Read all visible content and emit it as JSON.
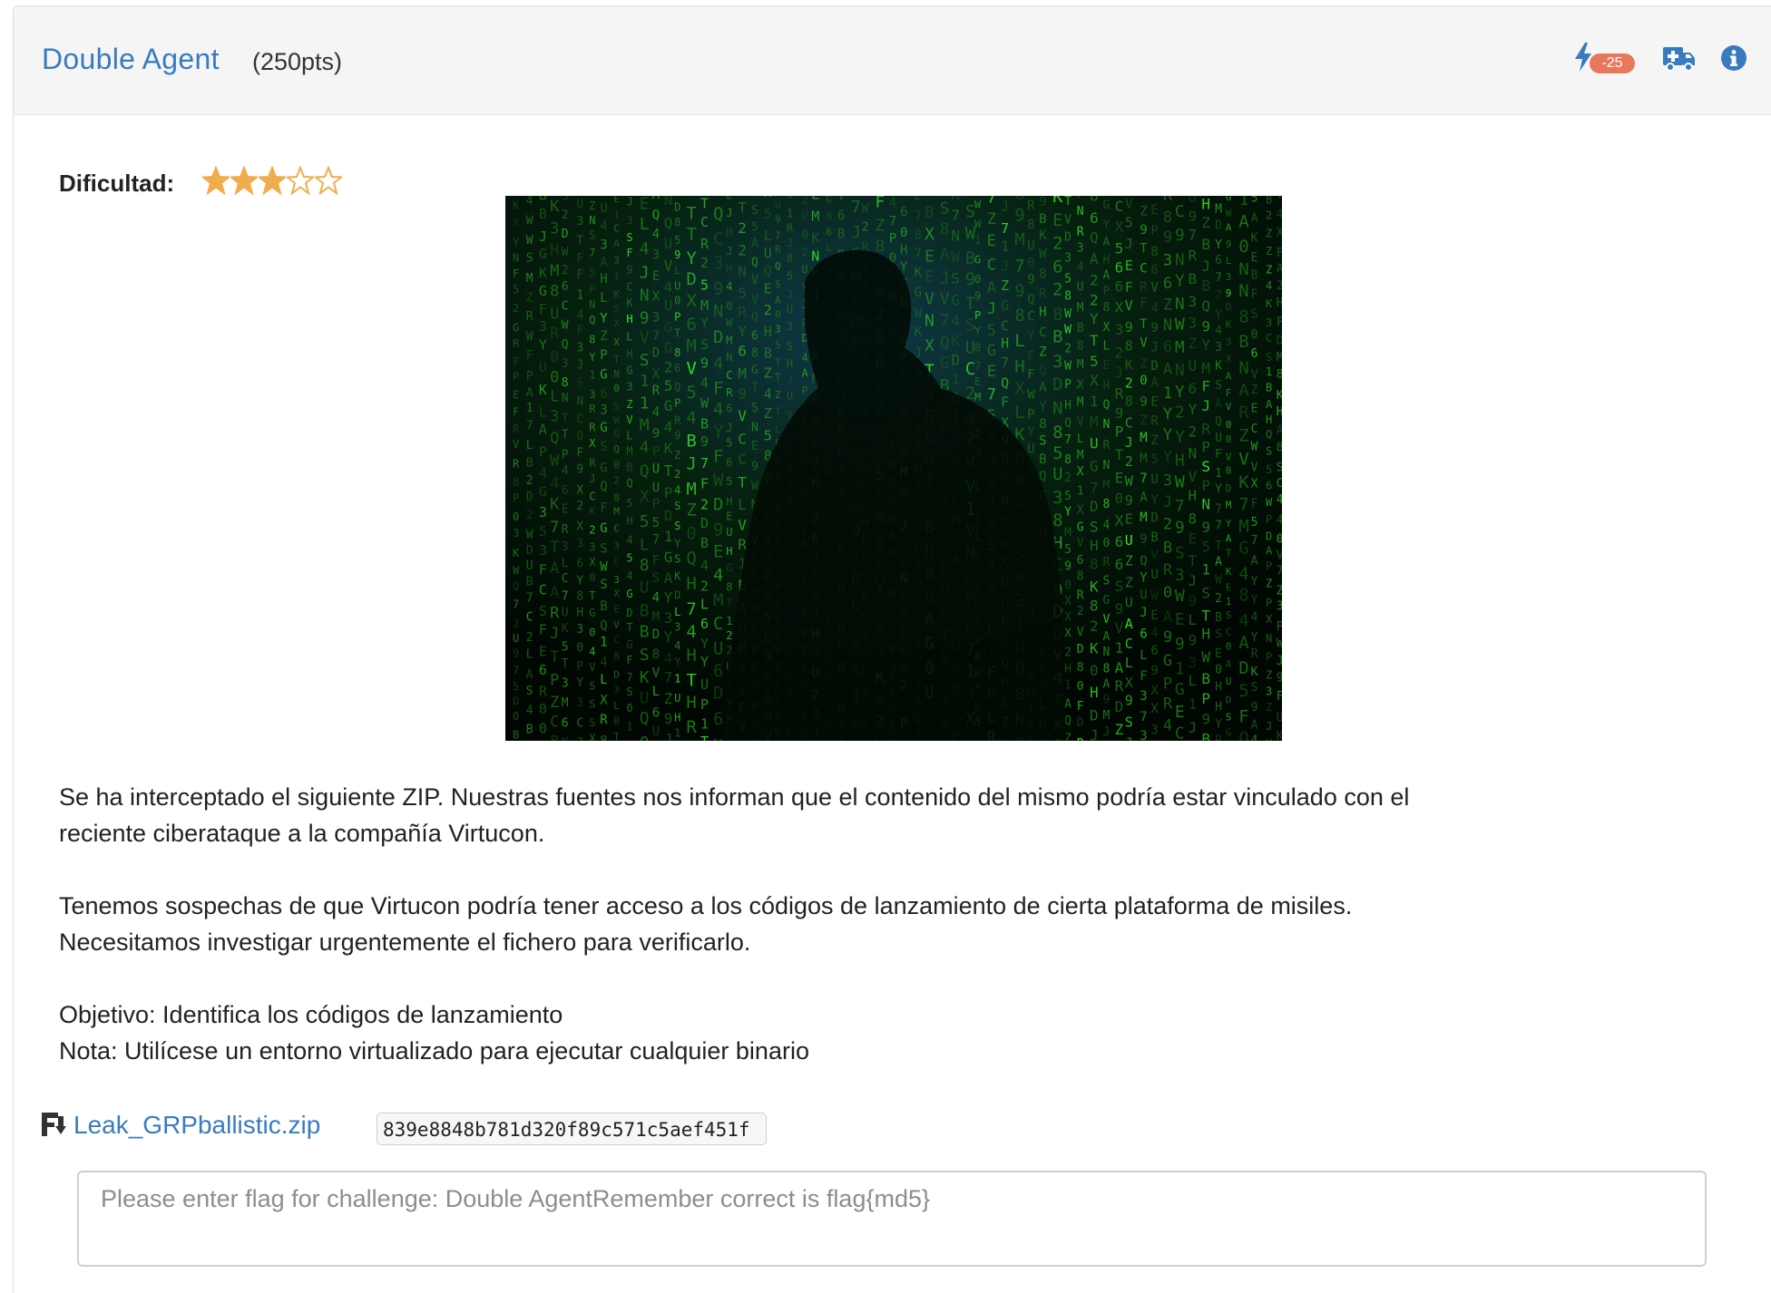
{
  "challenge": {
    "title": "Double Agent",
    "points": "(250pts)",
    "hint_penalty": "-25"
  },
  "header_icons": {
    "hint": "bolt-icon",
    "help": "ambulance-icon",
    "info": "info-icon"
  },
  "difficulty": {
    "label": "Dificultad:",
    "rating": 3,
    "max": 5,
    "star_color": "#f0ad4e"
  },
  "image": {
    "subject": "silhouette of a man over green matrix code rain"
  },
  "description": {
    "paragraph1": "Se ha interceptado el siguiente ZIP. Nuestras fuentes nos informan que el contenido del mismo podría estar vinculado con el\nreciente ciberataque a la compañía Virtucon.",
    "paragraph2": "Tenemos sospechas de que Virtucon podría tener acceso a los códigos de lanzamiento de cierta plataforma de misiles.\nNecesitamos investigar urgentemente el fichero para verificarlo.",
    "paragraph3": "Objetivo: Identifica los códigos de lanzamiento\nNota: Utilícese un entorno virtualizado para ejecutar cualquier binario"
  },
  "file": {
    "icon": "download-file-icon",
    "name": "Leak_GRPballistic.zip",
    "hash": "839e8848b781d320f89c571c5aef451f"
  },
  "flag_input": {
    "value": "",
    "placeholder": "Please enter flag for challenge: Double AgentRemember correct is flag{md5}"
  },
  "colors": {
    "link": "#3a7bbf",
    "badge": "#e9775c",
    "icon_blue": "#3a7bbf",
    "header_bg": "#f5f5f5"
  }
}
